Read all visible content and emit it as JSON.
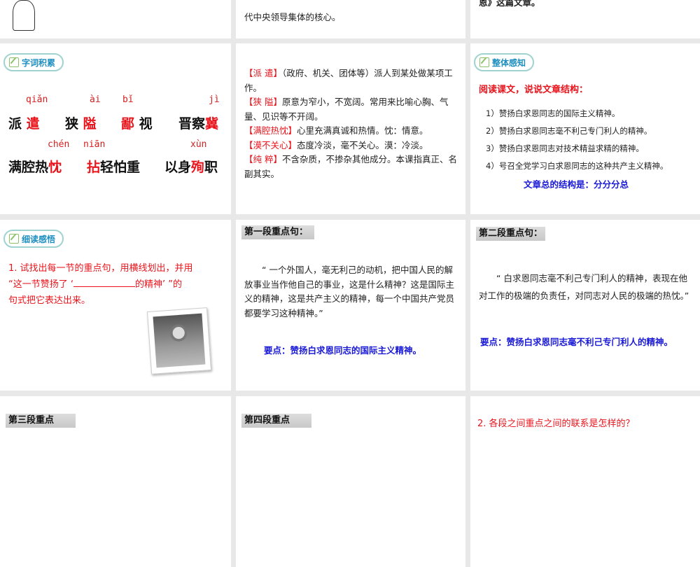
{
  "row1": {
    "middle_text": "代中央领导集体的核心。",
    "right_text": "恩》这篇文章。"
  },
  "vocab_slide": {
    "tag": "字词积累",
    "pinyin": [
      "qiǎn",
      "ài",
      "bǐ",
      "jì",
      "chén",
      "niān",
      "xùn"
    ],
    "words": {
      "w1a": "派",
      "w1b": "遣",
      "w2a": "狭",
      "w2b": "隘",
      "w3a": "鄙",
      "w3b": "视",
      "w4a": "晋察",
      "w4b": "冀",
      "w5a": "满腔热",
      "w5b": "忱",
      "w6a": "拈",
      "w6b": "轻怕重",
      "w7a": "以身",
      "w7b": "殉",
      "w7c": "职"
    }
  },
  "definitions": [
    {
      "term": "【派 遣】",
      "text": "（政府、机关、团体等）派人到某处做某项工作。"
    },
    {
      "term": "【狭 隘】",
      "text": "原意为窄小，不宽阔。常用来比喻心胸、气量、见识等不开阔。"
    },
    {
      "term": "【满腔热忱】",
      "text": "心里充满真诚和热情。忱：情意。"
    },
    {
      "term": "【漠不关心】",
      "text": "态度冷淡，毫不关心。漠：冷淡。"
    },
    {
      "term": "【纯 粹】",
      "text": "不含杂质，不掺杂其他成分。本课指真正、名副其实。"
    }
  ],
  "overview_slide": {
    "tag": "整体感知",
    "question": "阅读课文，说说文章结构：",
    "items": [
      "1）赞扬白求恩同志的国际主义精神。",
      "2）赞扬白求恩同志毫不利己专门利人的精神。",
      "3）赞扬白求恩同志对技术精益求精的精神。",
      "4）号召全党学习白求恩同志的这种共产主义精神。"
    ],
    "summary": "文章总的结构是：分分分总"
  },
  "reading_slide": {
    "tag": "细读感悟",
    "text_1": "1. 试找出每一节的重点句，用横线划出，并用",
    "text_2a": "“这一节赞扬了 ‘",
    "text_2b": "的精神’ ”的",
    "text_3": "句式把它表达出来。"
  },
  "para1_slide": {
    "heading": "第一段重点句：",
    "quote": "“ 一个外国人，毫无利己的动机，把中国人民的解放事业当作他自己的事业，这是什么精神？这是国际主义的精神，这是共产主义的精神，每一个中国共产党员都要学习这种精神。”",
    "key_point": "要点：赞扬白求恩同志的国际主义精神。"
  },
  "para2_slide": {
    "heading": "第二段重点句：",
    "quote": "“ 白求恩同志毫不利己专门利人的精神，表现在他对工作的极端的负责任，对同志对人民的极端的热忱。”",
    "key_point": "要点：赞扬白求恩同志毫不利己专门利人的精神。"
  },
  "row4": {
    "left_heading": "第三段重点",
    "middle_heading": "第四段重点",
    "right_text": "2. 各段之间重点之间的联系是怎样的？"
  }
}
